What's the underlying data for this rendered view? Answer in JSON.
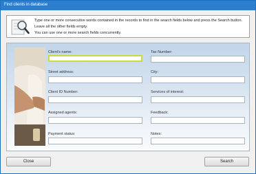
{
  "window": {
    "title": "Find clients in database"
  },
  "info": {
    "line1": "Type one or more consecutive words contained in the records to find in the search fields below and press the Search button.",
    "line2": "Leave all the other fields empty.",
    "line3": "You can use one or more search fields concurrently."
  },
  "form": {
    "clients_name": "Client's name:",
    "tax_number": "Tax Number:",
    "street_address": "Street address:",
    "city": "City:",
    "client_id": "Client ID Number:",
    "services": "Services of interest:",
    "agents": "Assigned agents:",
    "feedback": "Feedback:",
    "payment": "Payment status:",
    "notes": "Notes:"
  },
  "buttons": {
    "close": "Close",
    "search": "Search"
  },
  "icons": {
    "info": "magnifier-on-paper-icon"
  }
}
